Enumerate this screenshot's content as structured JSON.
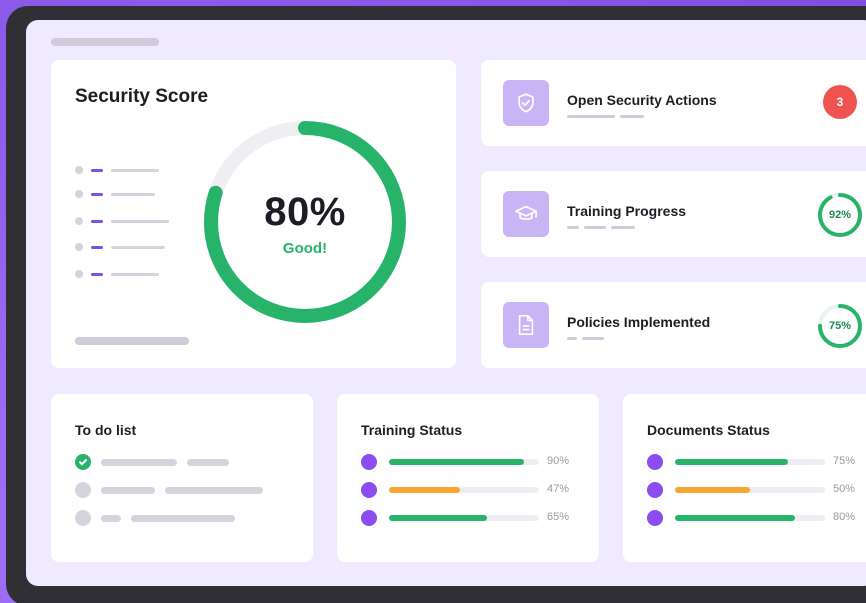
{
  "colors": {
    "accent_purple": "#8b4cf0",
    "green": "#27b36a",
    "orange": "#f7a630",
    "red": "#ef5350",
    "icon_bg": "#c9b4f6"
  },
  "security_score": {
    "title": "Security Score",
    "value_text": "80%",
    "value": 80,
    "status": "Good!"
  },
  "side_cards": [
    {
      "title": "Open Security Actions",
      "icon": "shield-check-icon",
      "badge": "3"
    },
    {
      "title": "Training Progress",
      "icon": "graduation-cap-icon",
      "ring_text": "92%",
      "ring_value": 92
    },
    {
      "title": "Policies Implemented",
      "icon": "document-icon",
      "ring_text": "75%",
      "ring_value": 75
    }
  ],
  "todo": {
    "title": "To do list",
    "items": [
      {
        "done": true
      },
      {
        "done": false
      },
      {
        "done": false
      }
    ]
  },
  "training_status": {
    "title": "Training Status",
    "rows": [
      {
        "value": 90,
        "label": "90%",
        "color": "#27b36a"
      },
      {
        "value": 47,
        "label": "47%",
        "color": "#f7a630"
      },
      {
        "value": 65,
        "label": "65%",
        "color": "#27b36a"
      }
    ]
  },
  "documents_status": {
    "title": "Documents Status",
    "rows": [
      {
        "value": 75,
        "label": "75%",
        "color": "#27b36a"
      },
      {
        "value": 50,
        "label": "50%",
        "color": "#f7a630"
      },
      {
        "value": 80,
        "label": "80%",
        "color": "#27b36a"
      }
    ]
  }
}
